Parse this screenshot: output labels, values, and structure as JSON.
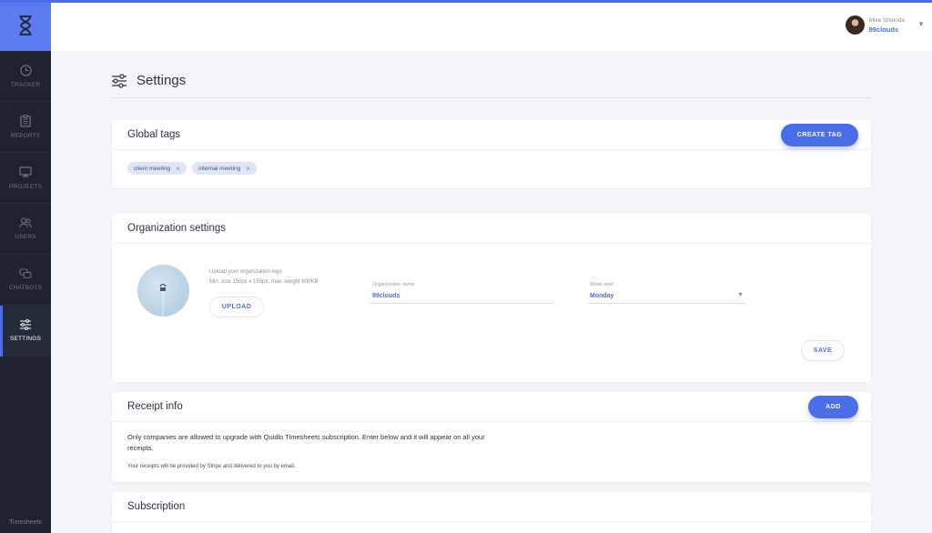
{
  "app": {
    "brand_footer": "Timesheets"
  },
  "sidebar": {
    "items": [
      {
        "label": "TRACKER",
        "icon": "clock-icon"
      },
      {
        "label": "REPORTS",
        "icon": "clipboard-icon"
      },
      {
        "label": "PROJECTS",
        "icon": "presentation-icon"
      },
      {
        "label": "USERS",
        "icon": "users-icon"
      },
      {
        "label": "CHATBOTS",
        "icon": "chat-icon"
      },
      {
        "label": "SETTINGS",
        "icon": "sliders-icon",
        "active": true
      }
    ]
  },
  "header": {
    "user_name": "Mike Shinoda",
    "user_org": "99clouds"
  },
  "page": {
    "title": "Settings"
  },
  "global_tags": {
    "title": "Global tags",
    "create_button": "CREATE TAG",
    "tags": [
      "client meeting",
      "internal meeting"
    ]
  },
  "organization": {
    "title": "Organization settings",
    "upload_hint_1": "Upload your organization logo",
    "upload_hint_2": "Min. size 150px x 150px, max. weight 800KB",
    "upload_button": "UPLOAD",
    "name_label": "Organization name",
    "name_value": "99clouds",
    "week_label": "Week start",
    "week_value": "Monday",
    "save_button": "SAVE"
  },
  "receipt": {
    "title": "Receipt info",
    "add_button": "ADD",
    "text": "Only companies are allowed to upgrade with Quidlo Timesheets subscription. Enter below and it will appear on all your receipts.",
    "note": "Your receipts will be provided by Stripe and delivered to you by email."
  },
  "subscription": {
    "title": "Subscription"
  },
  "colors": {
    "accent": "#4a6ee8",
    "sidebar_bg": "#1f2330",
    "logo_bg": "#5b7cf0",
    "page_bg": "#f4f5f8"
  }
}
